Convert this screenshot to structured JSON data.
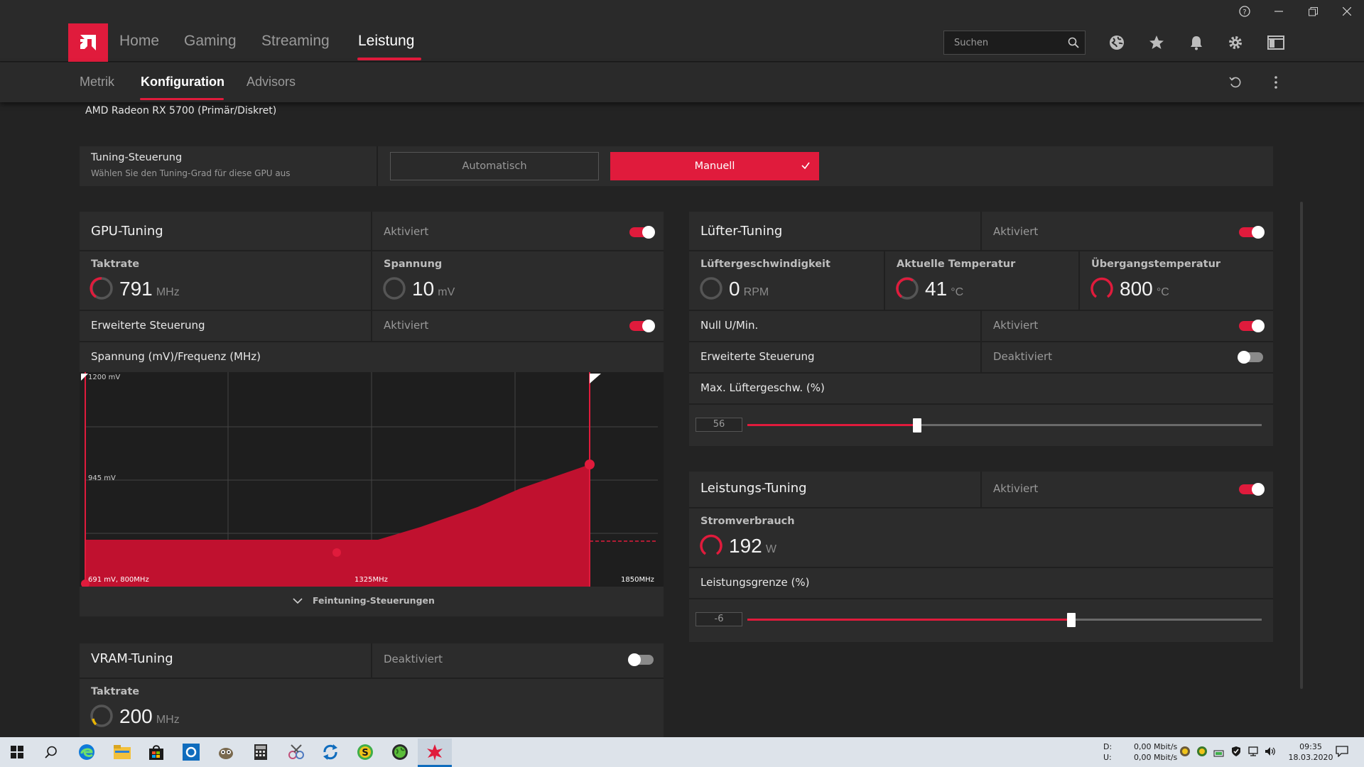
{
  "app": {
    "accent": "#e01b3c",
    "main_tabs": [
      {
        "label": "Home"
      },
      {
        "label": "Gaming"
      },
      {
        "label": "Streaming"
      },
      {
        "label": "Leistung"
      }
    ],
    "sub_tabs": [
      {
        "label": "Metrik"
      },
      {
        "label": "Konfiguration"
      },
      {
        "label": "Advisors"
      }
    ],
    "search_placeholder": "Suchen"
  },
  "device": "AMD Radeon RX 5700 (Primär/Diskret)",
  "tuning_control": {
    "label": "Tuning-Steuerung",
    "sublabel": "Wählen Sie den Tuning-Grad für diese GPU aus",
    "auto_label": "Automatisch",
    "manual_label": "Manuell",
    "selected": "Manuell"
  },
  "gpu_tuning": {
    "title": "GPU-Tuning",
    "status": "Aktiviert",
    "clock": {
      "label": "Taktrate",
      "value": "791",
      "unit": "MHz"
    },
    "voltage": {
      "label": "Spannung",
      "value": "10",
      "unit": "mV"
    },
    "advanced": {
      "label": "Erweiterte Steuerung",
      "status": "Aktiviert"
    },
    "curve_label": "Spannung (mV)/Frequenz (MHz)",
    "curve": {
      "y_top": "1200 mV",
      "y_mid": "945 mV",
      "x_left": "691 mV, 800MHz",
      "x_mid": "1325MHz",
      "x_right": "1850MHz"
    },
    "fine_tuning": "Feintuning-Steuerungen"
  },
  "vram_tuning": {
    "title": "VRAM-Tuning",
    "status": "Deaktiviert",
    "clock": {
      "label": "Taktrate",
      "value": "200",
      "unit": "MHz"
    }
  },
  "fan_tuning": {
    "title": "Lüfter-Tuning",
    "status": "Aktiviert",
    "fan_speed": {
      "label": "Lüftergeschwindigkeit",
      "value": "0",
      "unit": "RPM"
    },
    "current_temp": {
      "label": "Aktuelle Temperatur",
      "value": "41",
      "unit": "°C"
    },
    "junction_temp": {
      "label": "Übergangstemperatur",
      "value": "800",
      "unit": "°C"
    },
    "zero_rpm": {
      "label": "Null U/Min.",
      "status": "Aktiviert"
    },
    "advanced": {
      "label": "Erweiterte Steuerung",
      "status": "Deaktiviert"
    },
    "max_speed": {
      "label": "Max. Lüftergeschw. (%)",
      "value": "56",
      "fraction": 0.33
    }
  },
  "power_tuning": {
    "title": "Leistungs-Tuning",
    "status": "Aktiviert",
    "power": {
      "label": "Stromverbrauch",
      "value": "192",
      "unit": "W"
    },
    "limit": {
      "label": "Leistungsgrenze (%)",
      "value": "-6",
      "fraction": 0.63
    }
  },
  "taskbar": {
    "net_d_label": "D:",
    "net_u_label": "U:",
    "net_d": "0,00 Mbit/s",
    "net_u": "0,00 Mbit/s",
    "time": "09:35",
    "date": "18.03.2020"
  }
}
